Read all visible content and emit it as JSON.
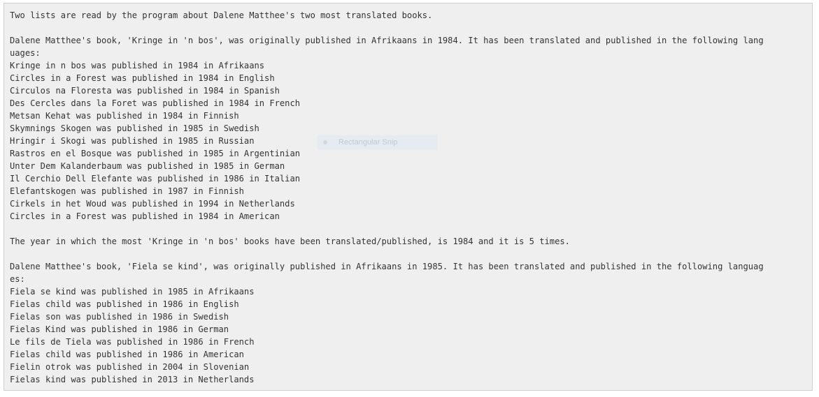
{
  "output": {
    "lines": [
      "Two lists are read by the program about Dalene Matthee's two most translated books.",
      "",
      "Dalene Matthee's book, 'Kringe in 'n bos', was originally published in Afrikaans in 1984. It has been translated and published in the following lang",
      "uages:",
      "Kringe in n bos was published in 1984 in Afrikaans",
      "Circles in a Forest was published in 1984 in English",
      "Circulos na Floresta was published in 1984 in Spanish",
      "Des Cercles dans la Foret was published in 1984 in French",
      "Metsan Kehat was published in 1984 in Finnish",
      "Skymnings Skogen was published in 1985 in Swedish",
      "Hringir i Skogi was published in 1985 in Russian",
      "Rastros en el Bosque was published in 1985 in Argentinian",
      "Unter Dem Kalanderbaum was published in 1985 in German",
      "Il Cerchio Dell Elefante was published in 1986 in Italian",
      "Elefantskogen was published in 1987 in Finnish",
      "Cirkels in het Woud was published in 1994 in Netherlands",
      "Circles in a Forest was published in 1984 in American",
      "",
      "The year in which the most 'Kringe in 'n bos' books have been translated/published, is 1984 and it is 5 times.",
      "",
      "Dalene Matthee's book, 'Fiela se kind', was originally published in Afrikaans in 1985. It has been translated and published in the following languag",
      "es:",
      "Fiela se kind was published in 1985 in Afrikaans",
      "Fielas child was published in 1986 in English",
      "Fielas son was published in 1986 in Swedish",
      "Fielas Kind was published in 1986 in German",
      "Le fils de Tiela was published in 1986 in French",
      "Fielas child was published in 1986 in American",
      "Fielin otrok was published in 2004 in Slovenian",
      "Fielas kind was published in 2013 in Netherlands"
    ]
  },
  "snip_tooltip": {
    "label": "Rectangular Snip",
    "icon": "snip-dot-icon"
  }
}
